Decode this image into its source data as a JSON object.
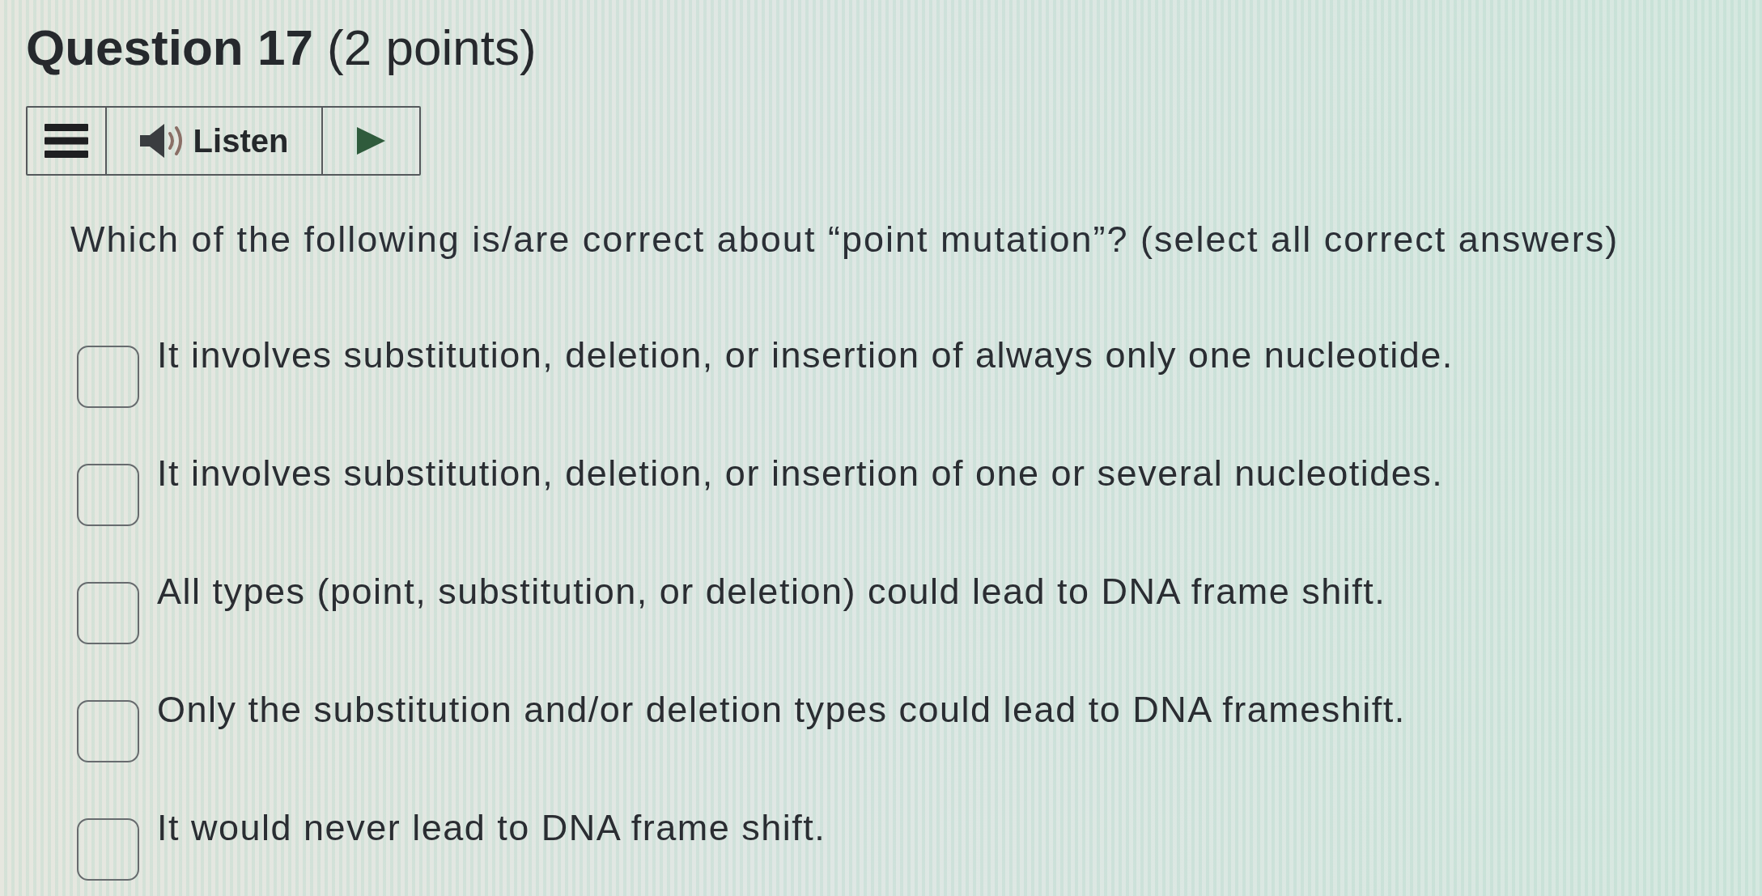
{
  "title": "**Question 17** (2 points)",
  "toolbar": {
    "listen_label": "Listen"
  },
  "prompt": "Which of the following is/are correct about “point mutation”? (select all correct answers)",
  "options": [
    {
      "label": "It involves substitution, deletion, or insertion of always only one nucleotide.",
      "checked": false
    },
    {
      "label": "It involves substitution, deletion, or insertion of one or several nucleotides.",
      "checked": false
    },
    {
      "label": "All types (point, substitution, or deletion) could lead to DNA frame shift.",
      "checked": false
    },
    {
      "label": "Only the substitution and/or deletion types could lead to DNA frameshift.",
      "checked": false
    },
    {
      "label": "It would never lead to DNA frame shift.",
      "checked": false
    }
  ]
}
